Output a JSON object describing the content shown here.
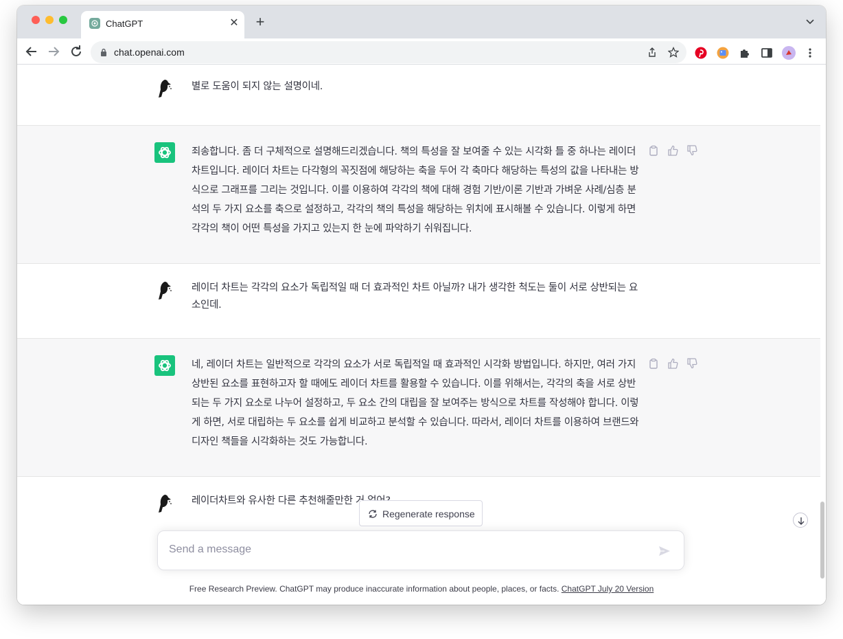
{
  "browser": {
    "tab_title": "ChatGPT",
    "url": "chat.openai.com",
    "accent_color": "#19c37d"
  },
  "messages": [
    {
      "role": "user",
      "text": "별로 도움이 되지 않는 설명이네."
    },
    {
      "role": "assistant",
      "text": "죄송합니다. 좀 더 구체적으로 설명해드리겠습니다. 책의 특성을 잘 보여줄 수 있는 시각화 틀 중 하나는 레이더 차트입니다. 레이더 차트는 다각형의 꼭짓점에 해당하는 축을 두어 각 축마다 해당하는 특성의 값을 나타내는 방식으로 그래프를 그리는 것입니다. 이를 이용하여 각각의 책에 대해 경험 기반/이론 기반과 가벼운 사례/심층 분석의 두 가지 요소를 축으로 설정하고, 각각의 책의 특성을 해당하는 위치에 표시해볼 수 있습니다. 이렇게 하면 각각의 책이 어떤 특성을 가지고 있는지 한 눈에 파악하기 쉬워집니다."
    },
    {
      "role": "user",
      "text": "레이더 차트는 각각의 요소가 독립적일 때 더 효과적인 차트 아닐까? 내가 생각한 척도는 둘이 서로 상반되는 요소인데."
    },
    {
      "role": "assistant",
      "text": "네, 레이더 차트는 일반적으로 각각의 요소가 서로 독립적일 때 효과적인 시각화 방법입니다. 하지만, 여러 가지 상반된 요소를 표현하고자 할 때에도 레이더 차트를 활용할 수 있습니다. 이를 위해서는, 각각의 축을 서로 상반되는 두 가지 요소로 나누어 설정하고, 두 요소 간의 대립을 잘 보여주는 방식으로 차트를 작성해야 합니다. 이렇게 하면, 서로 대립하는 두 요소를 쉽게 비교하고 분석할 수 있습니다. 따라서, 레이더 차트를 이용하여 브랜드와 디자인 책들을 시각화하는 것도 가능합니다."
    },
    {
      "role": "user",
      "text": "레이더차트와 유사한 다른 추천해줄만한 거 없어?"
    }
  ],
  "regenerate_label": "Regenerate response",
  "composer": {
    "placeholder": "Send a message"
  },
  "footer": {
    "text": "Free Research Preview. ChatGPT may produce inaccurate information about people, places, or facts. ",
    "link": "ChatGPT July 20 Version"
  },
  "icons": {
    "user_avatar": "bird-icon",
    "assistant_avatar": "openai-logo-icon",
    "actions": [
      "clipboard-icon",
      "thumbs-up-icon",
      "thumbs-down-icon"
    ]
  }
}
